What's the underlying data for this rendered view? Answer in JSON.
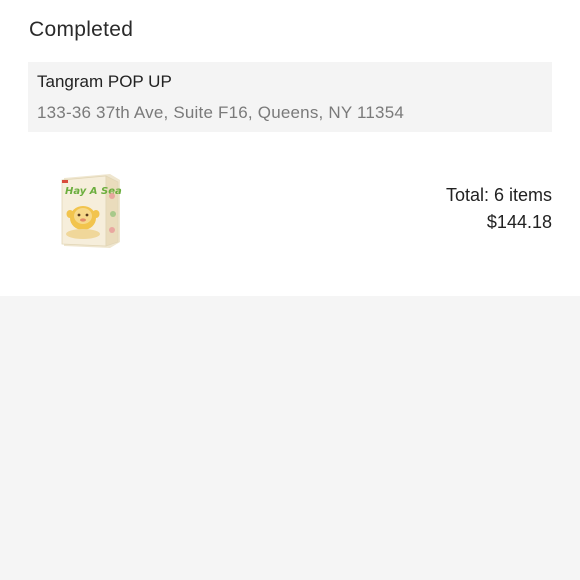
{
  "order": {
    "status": "Completed",
    "store": {
      "name": "Tangram POP UP",
      "address": "133-36 37th Ave, Suite F16, Queens, NY 11354"
    },
    "product": {
      "thumbnail_icon": "blind-box-product-image",
      "box_text": "Hay A Seat"
    },
    "total_items_text": "Total: 6 items",
    "total_price": "$144.18"
  }
}
